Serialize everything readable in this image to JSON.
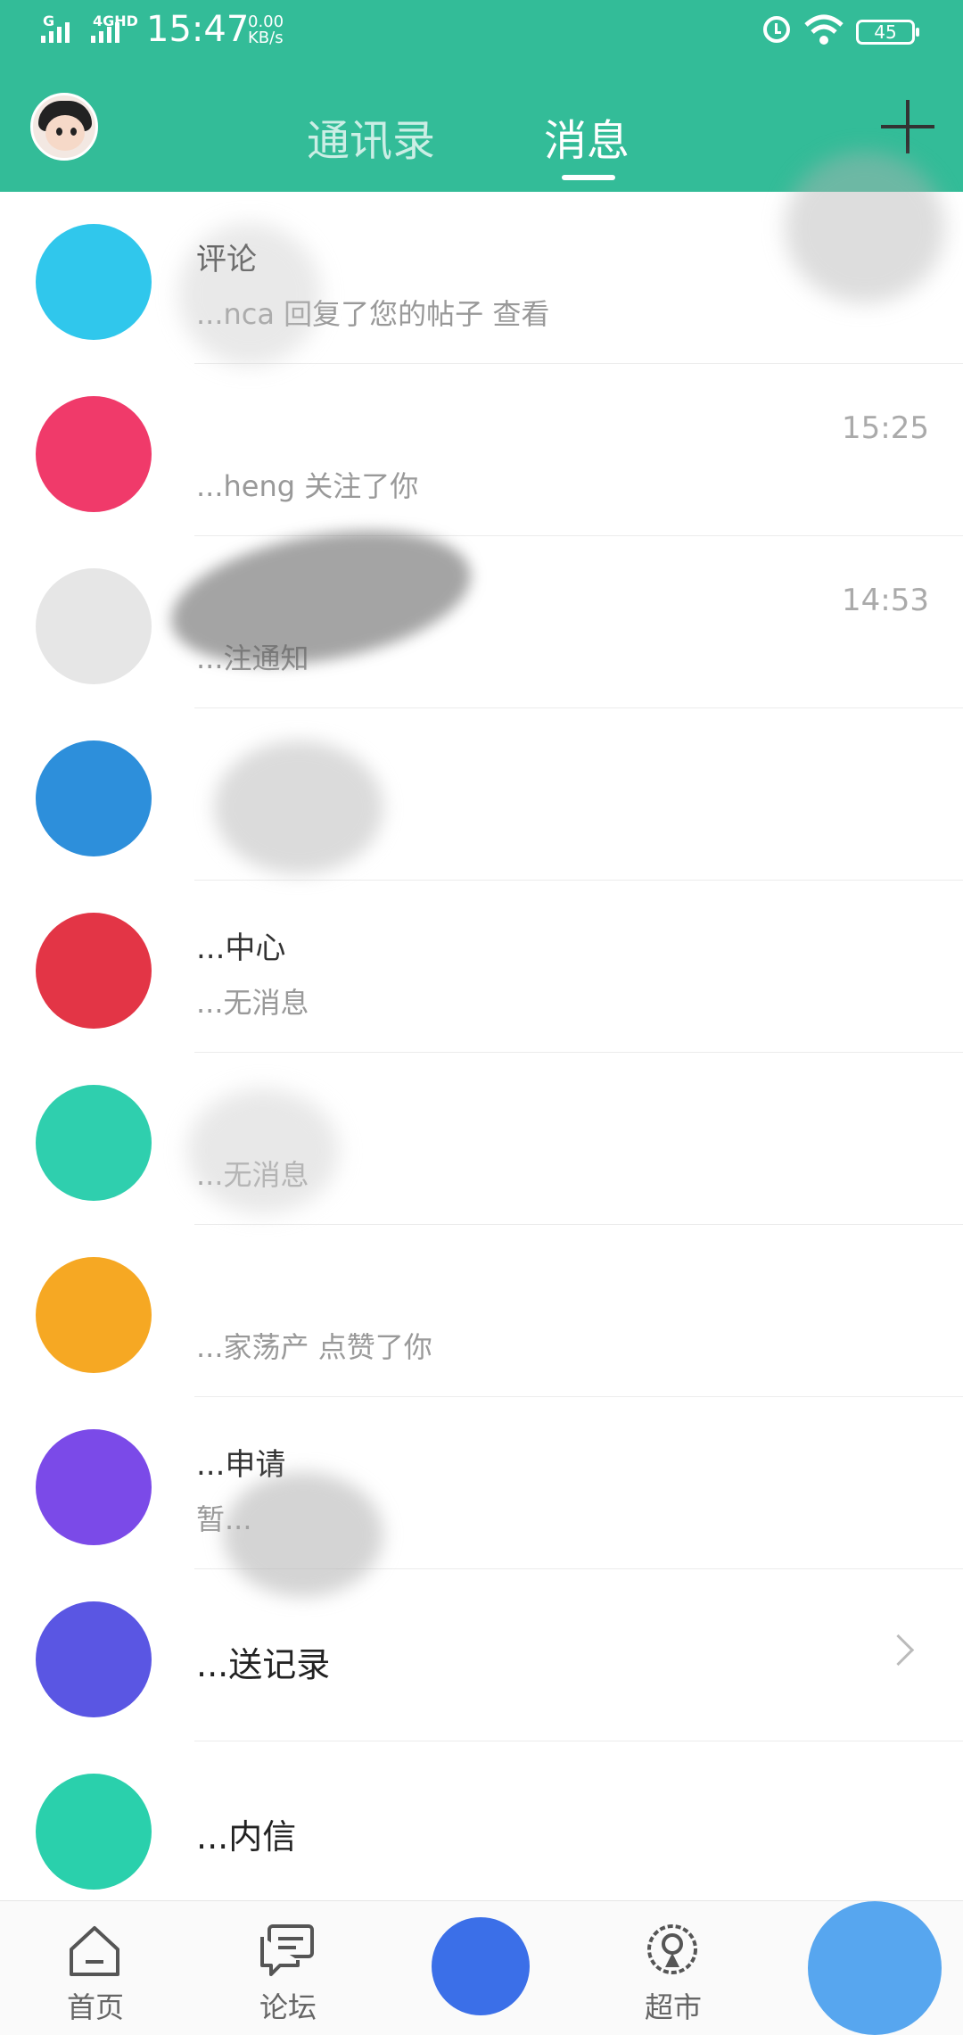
{
  "status_bar": {
    "network_label": "G",
    "network_label2": "4GHD",
    "time": "15:47",
    "speed_value": "0.00",
    "speed_unit": "KB/s",
    "battery": "45"
  },
  "header": {
    "tab_contacts": "通讯录",
    "tab_messages": "消息",
    "active_tab": "消息",
    "accent_color": "#33bc98"
  },
  "messages": [
    {
      "title": "评论",
      "subtitle": "...nca 回复了您的帖子  查看",
      "time": "",
      "icon": "chat-bubble-icon",
      "color": "#30c7ec"
    },
    {
      "title": "",
      "subtitle": "...heng 关注了你",
      "time": "15:25",
      "icon": "person-icon",
      "color": "#f03a6a"
    },
    {
      "title": "",
      "subtitle": "...注通知",
      "time": "14:53",
      "icon": "bell-icon",
      "color": "#dddddd"
    },
    {
      "title": "",
      "subtitle": "",
      "time": "",
      "icon": "mail-icon",
      "color": "#2d8fdb"
    },
    {
      "title": "...中心",
      "subtitle": "...无消息",
      "time": "",
      "icon": "service-icon",
      "color": "#e33546"
    },
    {
      "title": "",
      "subtitle": "...无消息",
      "time": "",
      "icon": "at-icon",
      "color": "#2fcfae"
    },
    {
      "title": "",
      "subtitle": "...家荡产 点赞了你",
      "time": "",
      "icon": "thumb-icon",
      "color": "#f6a823"
    },
    {
      "title": "...申请",
      "subtitle": "暂...",
      "time": "",
      "icon": "friend-request-icon",
      "color": "#7b4ae8"
    },
    {
      "title": "...送记录",
      "subtitle": "",
      "time": "",
      "icon": "send-record-icon",
      "color": "#5a56e3",
      "chevron": true
    },
    {
      "title": "...内信",
      "subtitle": "",
      "time": "",
      "icon": "inbox-icon",
      "color": "#2ad0ac"
    }
  ],
  "bottom_nav": {
    "items": [
      {
        "label": "首页",
        "icon": "home-icon"
      },
      {
        "label": "论坛",
        "icon": "forum-icon"
      },
      {
        "label": "",
        "icon": "publish-icon"
      },
      {
        "label": "超市",
        "icon": "market-icon"
      },
      {
        "label": "",
        "icon": "me-icon"
      }
    ]
  }
}
